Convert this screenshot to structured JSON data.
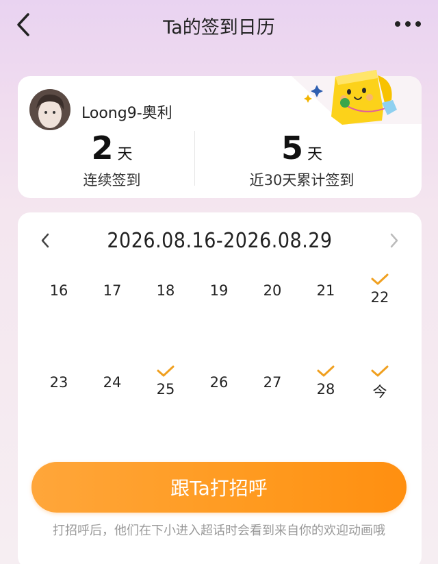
{
  "header": {
    "title": "Ta的签到日历"
  },
  "profile": {
    "username": "Loong9-奥利"
  },
  "stats": {
    "streak_value": "2",
    "streak_unit": "天",
    "streak_label": "连续签到",
    "total_value": "5",
    "total_unit": "天",
    "total_label": "近30天累计签到"
  },
  "calendar": {
    "range": "2026.08.16-2026.08.29",
    "days": [
      {
        "label": "16",
        "checked": false
      },
      {
        "label": "17",
        "checked": false
      },
      {
        "label": "18",
        "checked": false
      },
      {
        "label": "19",
        "checked": false
      },
      {
        "label": "20",
        "checked": false
      },
      {
        "label": "21",
        "checked": false
      },
      {
        "label": "22",
        "checked": true
      },
      {
        "label": "23",
        "checked": false
      },
      {
        "label": "24",
        "checked": false
      },
      {
        "label": "25",
        "checked": true
      },
      {
        "label": "26",
        "checked": false
      },
      {
        "label": "27",
        "checked": false
      },
      {
        "label": "28",
        "checked": true
      },
      {
        "label": "今",
        "checked": true
      }
    ]
  },
  "actions": {
    "greet_label": "跟Ta打招呼"
  },
  "footnote": {
    "text": "打招呼后，他们在下小进入超话时会看到来自你的欢迎动画哦"
  },
  "colors": {
    "accent_orange": "#ff9a1f",
    "check_color": "#f0a020",
    "background_top": "#e9d3f1"
  },
  "icons": {
    "back": "back-chevron-icon",
    "more": "more-dots-icon",
    "prev": "chevron-left-icon",
    "next": "chevron-right-icon",
    "check": "checkmark-icon"
  }
}
